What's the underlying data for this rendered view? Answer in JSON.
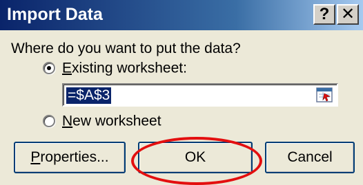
{
  "dialog": {
    "title": "Import Data",
    "help_label": "?",
    "close_label": "✕"
  },
  "prompt": "Where do you want to put the data?",
  "options": {
    "existing": {
      "label_first": "E",
      "label_rest": "xisting worksheet:",
      "selected": true
    },
    "new": {
      "label_first": "N",
      "label_rest": "ew worksheet",
      "selected": false
    }
  },
  "reference": {
    "value": "=$A$3"
  },
  "buttons": {
    "properties_mnemonic": "P",
    "properties_rest": "roperties...",
    "ok": "OK",
    "cancel": "Cancel"
  },
  "colors": {
    "annotation": "#e30f0f",
    "title_bar": "#0a246a"
  }
}
